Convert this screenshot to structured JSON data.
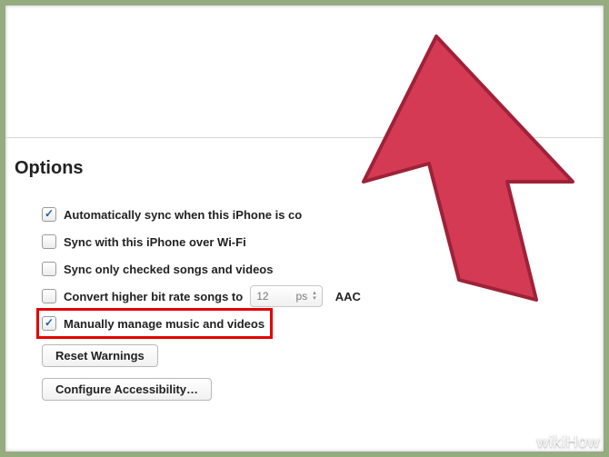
{
  "section": {
    "title": "Options"
  },
  "options": {
    "auto_sync": {
      "label": "Automatically sync when this iPhone is co",
      "checked": true
    },
    "wifi_sync": {
      "label": "Sync with this iPhone over Wi-Fi",
      "checked": false
    },
    "checked_only": {
      "label": "Sync only checked songs and videos",
      "checked": false
    },
    "convert": {
      "label": "Convert higher bit rate songs to",
      "checked": false,
      "select_value": "12         ps",
      "after": "AAC"
    },
    "manual": {
      "label": "Manually manage music and videos",
      "checked": true
    }
  },
  "buttons": {
    "reset_warnings": "Reset Warnings",
    "configure_accessibility": "Configure Accessibility…"
  },
  "watermark": {
    "wiki": "wiki",
    "how": "How"
  },
  "colors": {
    "highlight": "#e40000",
    "arrow": "#d43a54",
    "arrow_stroke": "#9e2238"
  }
}
